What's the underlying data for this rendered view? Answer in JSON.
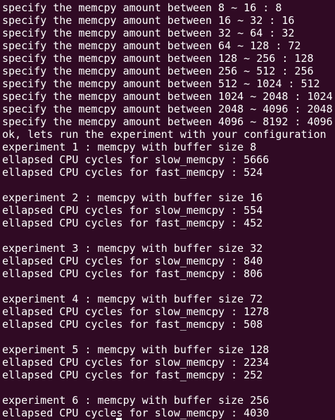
{
  "terminal": {
    "background": "#300a24",
    "foreground": "#ffffff",
    "lines": [
      "specify the memcpy amount between 8 ~ 16 : 8",
      "specify the memcpy amount between 16 ~ 32 : 16",
      "specify the memcpy amount between 32 ~ 64 : 32",
      "specify the memcpy amount between 64 ~ 128 : 72",
      "specify the memcpy amount between 128 ~ 256 : 128",
      "specify the memcpy amount between 256 ~ 512 : 256",
      "specify the memcpy amount between 512 ~ 1024 : 512",
      "specify the memcpy amount between 1024 ~ 2048 : 1024",
      "specify the memcpy amount between 2048 ~ 4096 : 2048",
      "specify the memcpy amount between 4096 ~ 8192 : 4096",
      "ok, lets run the experiment with your configuration",
      "experiment 1 : memcpy with buffer size 8",
      "ellapsed CPU cycles for slow_memcpy : 5666",
      "ellapsed CPU cycles for fast_memcpy : 524",
      "",
      "experiment 2 : memcpy with buffer size 16",
      "ellapsed CPU cycles for slow_memcpy : 554",
      "ellapsed CPU cycles for fast_memcpy : 452",
      "",
      "experiment 3 : memcpy with buffer size 32",
      "ellapsed CPU cycles for slow_memcpy : 840",
      "ellapsed CPU cycles for fast_memcpy : 806",
      "",
      "experiment 4 : memcpy with buffer size 72",
      "ellapsed CPU cycles for slow_memcpy : 1278",
      "ellapsed CPU cycles for fast_memcpy : 508",
      "",
      "experiment 5 : memcpy with buffer size 128",
      "ellapsed CPU cycles for slow_memcpy : 2234",
      "ellapsed CPU cycles for fast_memcpy : 252",
      "",
      "experiment 6 : memcpy with buffer size 256",
      "ellapsed CPU cycles for slow_memcpy : 4030"
    ]
  }
}
